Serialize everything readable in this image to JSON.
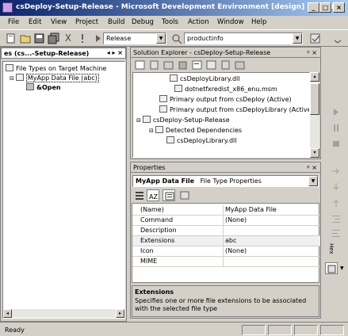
{
  "window": {
    "title": "csDeploy-Setup-Release - Microsoft Development Environment [design] - File Ty..."
  },
  "menu": [
    "File",
    "Edit",
    "View",
    "Project",
    "Build",
    "Debug",
    "Tools",
    "Action",
    "Window",
    "Help"
  ],
  "toolbar": {
    "config_value": "Release",
    "project_value": "productinfo"
  },
  "left_panel": {
    "title": "es (cs...-Setup-Release)",
    "nav_label": "◂ ▸ ×",
    "tree": [
      "File Types on Target Machine",
      "MyApp Data File (abc)",
      "&Open"
    ]
  },
  "solution_explorer": {
    "title": "Solution Explorer - csDeploy-Setup-Release",
    "pin": "ᵖ ×",
    "items": [
      "csDeployLibrary.dll",
      "dotnetfxredist_x86_enu.msm",
      "Primary output from csDeploy (Active)",
      "Primary output from csDeployLibrary (Active)",
      "csDeploy-Setup-Release",
      "Detected Dependencies",
      "csDeployLibrary.dll"
    ]
  },
  "properties": {
    "title": "Properties",
    "pin": "ᵖ ×",
    "object_name": "MyApp Data File",
    "object_type": "File Type Properties",
    "rows": [
      {
        "key": "(Name)",
        "value": "MyApp Data File"
      },
      {
        "key": "Command",
        "value": "(None)"
      },
      {
        "key": "Description",
        "value": ""
      },
      {
        "key": "Extensions",
        "value": "abc"
      },
      {
        "key": "Icon",
        "value": "(None)"
      },
      {
        "key": "MIME",
        "value": ""
      }
    ],
    "desc_title": "Extensions",
    "desc_text": "Specifies one or more file extensions to be associated with the selected file type"
  },
  "right_toolbar": {
    "label": "Hex"
  },
  "status": {
    "text": "Ready"
  }
}
